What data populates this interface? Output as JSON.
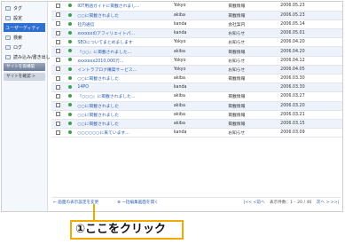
{
  "sidebar": {
    "items": [
      {
        "label": "タグ",
        "active": false
      },
      {
        "label": "設定",
        "active": false
      },
      {
        "label": "ユーザーディティ",
        "active": true
      },
      {
        "label": "検索",
        "active": false
      },
      {
        "label": "ログ",
        "active": false
      },
      {
        "label": "読み込み/書き出し",
        "active": false
      },
      {
        "label": "サイトを再構築",
        "active": false
      },
      {
        "label": "サイトを確認 >",
        "active": false
      }
    ]
  },
  "table": {
    "rows": [
      {
        "title": "IOT用語ガイドに掲載されまし...",
        "user": "Yokyo",
        "category": "掲載情報",
        "date": "2006.05.23"
      },
      {
        "title": "○○に掲載されました",
        "user": "akiba",
        "category": "掲載情報",
        "date": "2006.05.23"
      },
      {
        "title": "社内通信",
        "user": "kanda",
        "category": "会社案内",
        "date": "2006.05.14"
      },
      {
        "title": "xxxxxxのアフィリエイトパ...",
        "user": "kanda",
        "category": "お知らせ",
        "date": "2006.05.01"
      },
      {
        "title": "SEOについてまとめまします",
        "user": "Yokyo",
        "category": "お知らせ",
        "date": "2006.04.20"
      },
      {
        "title": "『○○』に掲載されました...",
        "user": "akiba",
        "category": "掲載情報",
        "date": "2006.04.20"
      },
      {
        "title": "xxxxxxx2010,000万...",
        "user": "Yokyo",
        "category": "お知らせ",
        "date": "2006.04.12"
      },
      {
        "title": "イントラブログ構築サービス...",
        "user": "Yokyo",
        "category": "お知らせ",
        "date": "2006.04.05"
      },
      {
        "title": "○○に掲載されました",
        "user": "akiba",
        "category": "掲載情報",
        "date": "2006.03.30"
      },
      {
        "title": "14PO",
        "user": "kanda",
        "category": "",
        "date": "2006.03.30"
      },
      {
        "title": "『○○○』に掲載されました...",
        "user": "akiba",
        "category": "掲載情報",
        "date": "2006.03.27"
      },
      {
        "title": "○○に掲載されました",
        "user": "akiba",
        "category": "掲載情報",
        "date": "2006.03.20"
      },
      {
        "title": "○○に掲載されました",
        "user": "akiba",
        "category": "掲載情報",
        "date": "2006.03.21"
      },
      {
        "title": "○○に掲載されました",
        "user": "akiba",
        "category": "掲載情報",
        "date": "2006.03.15"
      },
      {
        "title": "○○○○○○に来ています...",
        "user": "kanda",
        "category": "お知らせ",
        "date": "2006.03.09"
      }
    ]
  },
  "footer": {
    "link_left": "← 画面の表示設定を変更",
    "link_left2": "⊕ 一括編集画面を開く",
    "pager_prev": "|<< <前へ",
    "pager_info": "表示件数：1 – 20 / 46",
    "pager_next": "次へ > >>|"
  },
  "callout": {
    "text": "①ここをクリック"
  }
}
